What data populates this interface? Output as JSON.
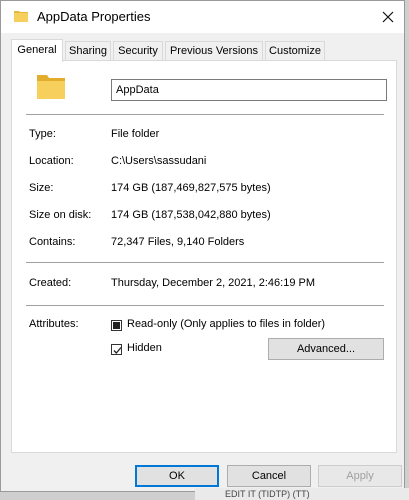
{
  "window": {
    "title": "AppData Properties",
    "close_icon": "close-icon"
  },
  "tabs": [
    {
      "label": "General"
    },
    {
      "label": "Sharing"
    },
    {
      "label": "Security"
    },
    {
      "label": "Previous Versions"
    },
    {
      "label": "Customize"
    }
  ],
  "general": {
    "folder_icon": "folder-icon",
    "name": "AppData",
    "type_label": "Type:",
    "type_value": "File folder",
    "location_label": "Location:",
    "location_value": "C:\\Users\\sassudani",
    "size_label": "Size:",
    "size_value": "174 GB (187,469,827,575 bytes)",
    "size_on_disk_label": "Size on disk:",
    "size_on_disk_value": "174 GB (187,538,042,880 bytes)",
    "contains_label": "Contains:",
    "contains_value": "72,347 Files, 9,140 Folders",
    "created_label": "Created:",
    "created_value": "Thursday, December 2, 2021, 2:46:19 PM",
    "attributes_label": "Attributes:",
    "readonly_label": "Read-only (Only applies to files in folder)",
    "readonly_state": "indeterminate",
    "hidden_label": "Hidden",
    "hidden_state": "checked",
    "advanced_label": "Advanced..."
  },
  "buttons": {
    "ok": "OK",
    "cancel": "Cancel",
    "apply": "Apply"
  },
  "background": {
    "partial_text": "EDIT IT (TIDTP) (TT)"
  },
  "colors": {
    "accent": "#0078d7",
    "folder": "#f3c74f"
  }
}
